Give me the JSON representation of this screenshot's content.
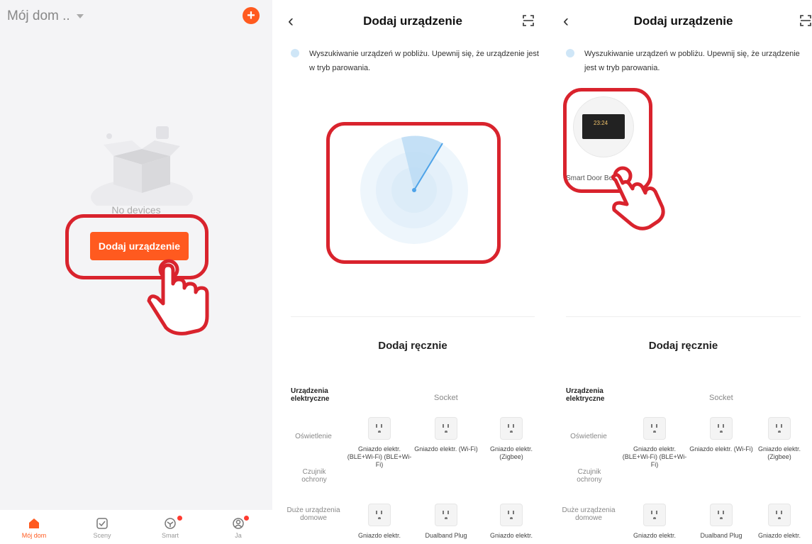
{
  "screen1": {
    "home_title": "Mój dom ..",
    "empty_text": "No devices",
    "add_button": "Dodaj urządzenie",
    "tabs": [
      {
        "label": "Mój dom",
        "icon": "home-icon",
        "active": true
      },
      {
        "label": "Sceny",
        "icon": "scenes-icon",
        "active": false
      },
      {
        "label": "Smart",
        "icon": "smart-icon",
        "active": false
      },
      {
        "label": "Ja",
        "icon": "profile-icon",
        "active": false
      }
    ]
  },
  "screen2": {
    "title": "Dodaj urządzenie",
    "search_info": "Wyszukiwanie urządzeń w pobliżu. Upewnij się, że urządzenie jest w tryb parowania.",
    "manual_title": "Dodaj ręcznie",
    "categories": [
      "Urządzenia elektryczne",
      "Oświetlenie",
      "Czujnik ochrony",
      "Duże urządzenia domowe"
    ],
    "socket_label": "Socket",
    "devices": [
      "Gniazdo elektr. (BLE+Wi-Fi) (BLE+Wi-Fi)",
      "Gniazdo elektr. (Wi-Fi)",
      "Gniazdo elektr. (Zigbee)",
      "Gniazdo elektr.",
      "Dualband Plug",
      "Gniazdo elektr."
    ]
  },
  "screen3": {
    "title": "Dodaj urządzenie",
    "search_info": "Wyszukiwanie urządzeń w pobliżu. Upewnij się, że urządzenie jest w tryb parowania.",
    "found_device": "Smart Door Bell",
    "found_time": "23:24",
    "manual_title": "Dodaj ręcznie",
    "categories": [
      "Urządzenia elektryczne",
      "Oświetlenie",
      "Czujnik ochrony",
      "Duże urządzenia domowe"
    ],
    "socket_label": "Socket",
    "devices": [
      "Gniazdo elektr. (BLE+Wi-Fi) (BLE+Wi-Fi)",
      "Gniazdo elektr. (Wi-Fi)",
      "Gniazdo elektr. (Zigbee)",
      "Gniazdo elektr.",
      "Dualband Plug",
      "Gniazdo elektr."
    ]
  },
  "colors": {
    "accent": "#ff5a1f",
    "highlight": "#d9232d",
    "radar": "#4ea3e8"
  }
}
